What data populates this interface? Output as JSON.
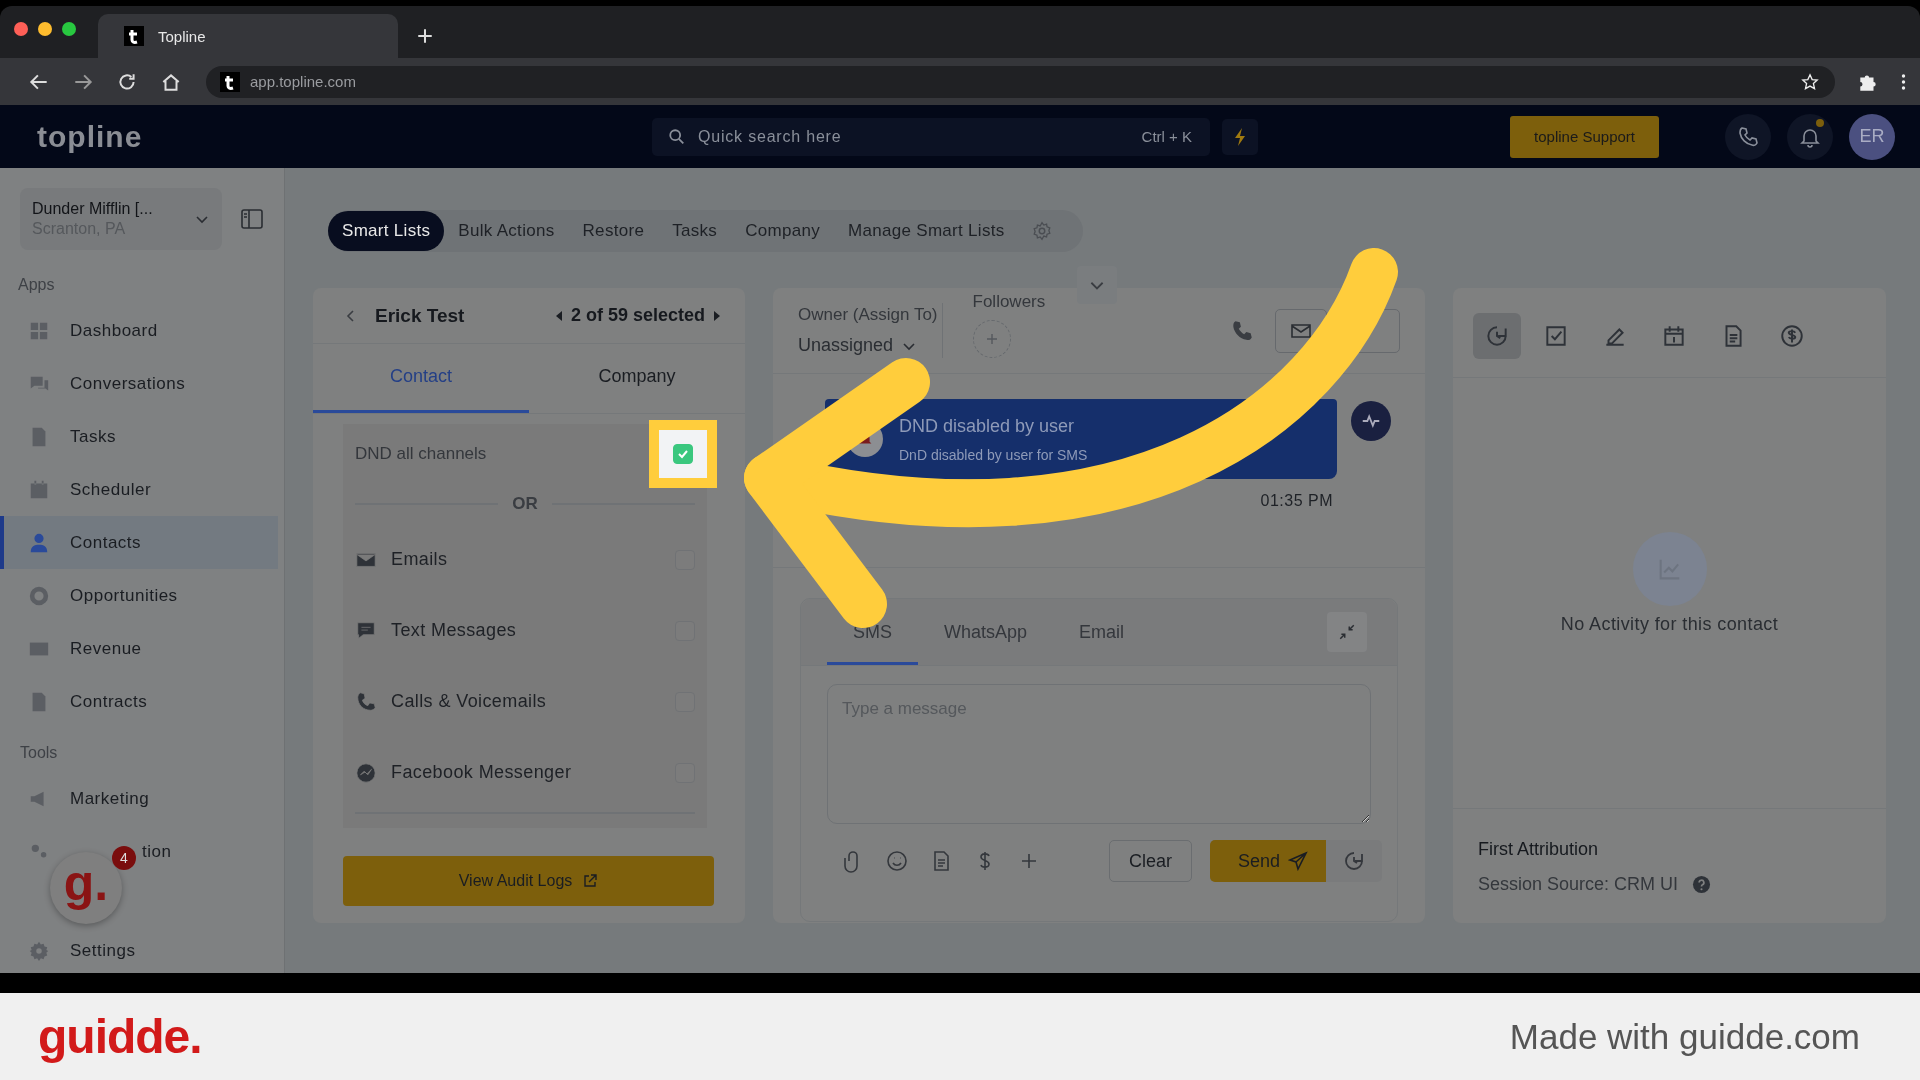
{
  "browser": {
    "tab_title": "Topline",
    "url": "app.topline.com"
  },
  "header": {
    "logo": "topline",
    "search": {
      "placeholder": "Quick search here",
      "shortcut": "Ctrl + K"
    },
    "support_button": "topline Support",
    "notification_dot": true,
    "avatar": "ER"
  },
  "sidebar": {
    "account": {
      "name": "Dunder Mifflin [...",
      "location": "Scranton, PA"
    },
    "sections": [
      {
        "title": "Apps",
        "items": [
          {
            "label": "Dashboard",
            "selected": false
          },
          {
            "label": "Conversations",
            "selected": false
          },
          {
            "label": "Tasks",
            "selected": false
          },
          {
            "label": "Scheduler",
            "selected": false
          },
          {
            "label": "Contacts",
            "selected": true
          },
          {
            "label": "Opportunities",
            "selected": false
          },
          {
            "label": "Revenue",
            "selected": false
          },
          {
            "label": "Contracts",
            "selected": false
          }
        ]
      },
      {
        "title": "Tools",
        "items": [
          {
            "label": "Marketing",
            "selected": false
          },
          {
            "label": "tion",
            "selected": false
          }
        ]
      }
    ],
    "settings": "Settings"
  },
  "top_tabs": [
    {
      "label": "Smart Lists",
      "selected": true
    },
    {
      "label": "Bulk Actions",
      "selected": false
    },
    {
      "label": "Restore",
      "selected": false
    },
    {
      "label": "Tasks",
      "selected": false
    },
    {
      "label": "Company",
      "selected": false
    },
    {
      "label": "Manage Smart Lists",
      "selected": false
    }
  ],
  "contact_panel": {
    "name": "Erick Test",
    "pager": "2 of 59 selected",
    "tabs": [
      {
        "label": "Contact",
        "selected": true
      },
      {
        "label": "Company",
        "selected": false
      }
    ],
    "dnd_all": {
      "label": "DND all channels",
      "checked": true,
      "highlighted": true
    },
    "divider": "OR",
    "channels": [
      {
        "label": "Emails",
        "checked": false
      },
      {
        "label": "Text Messages",
        "checked": false
      },
      {
        "label": "Calls & Voicemails",
        "checked": false
      },
      {
        "label": "Facebook Messenger",
        "checked": false
      }
    ],
    "audit_button": "View Audit Logs"
  },
  "conversation": {
    "owner_label": "Owner (Assign To)",
    "owner_value": "Unassigned",
    "followers_label": "Followers",
    "event": {
      "title": "DND disabled by user",
      "detail": "DnD disabled by user for SMS",
      "time": "01:35 PM"
    },
    "composer": {
      "tabs": [
        {
          "label": "SMS",
          "selected": true
        },
        {
          "label": "WhatsApp",
          "selected": false
        },
        {
          "label": "Email",
          "selected": false
        }
      ],
      "placeholder": "Type a message",
      "clear_button": "Clear",
      "send_button": "Send"
    }
  },
  "activity": {
    "tools": [
      {
        "selected": true
      },
      {
        "selected": false
      },
      {
        "selected": false
      },
      {
        "selected": false
      },
      {
        "selected": false
      },
      {
        "selected": false
      }
    ],
    "empty_text": "No Activity for this contact",
    "attribution_title": "First Attribution",
    "session_source": "Session Source: CRM UI"
  },
  "guidde_widget": {
    "logo": "g.",
    "badge": "4"
  },
  "footer": {
    "brand": "guidde.",
    "tagline": "Made with guidde.com"
  }
}
